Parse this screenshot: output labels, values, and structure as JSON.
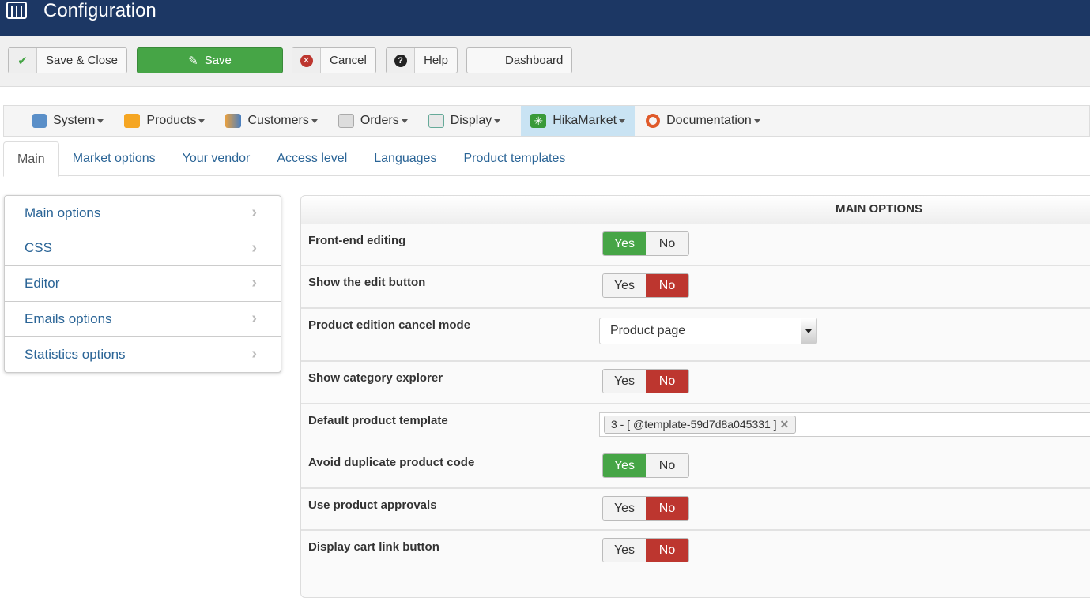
{
  "header": {
    "title": "Configuration",
    "icon": "sliders-icon"
  },
  "toolbar": {
    "save_close": "Save & Close",
    "save": "Save",
    "cancel": "Cancel",
    "help": "Help",
    "dashboard": "Dashboard"
  },
  "menu": [
    {
      "label": "System",
      "icon": "tools-icon"
    },
    {
      "label": "Products",
      "icon": "box-icon"
    },
    {
      "label": "Customers",
      "icon": "users-icon"
    },
    {
      "label": "Orders",
      "icon": "orders-icon"
    },
    {
      "label": "Display",
      "icon": "display-icon"
    },
    {
      "label": "HikaMarket",
      "icon": "hikamarket-icon"
    },
    {
      "label": "Documentation",
      "icon": "lifebuoy-icon"
    }
  ],
  "tabs": [
    "Main",
    "Market options",
    "Your vendor",
    "Access level",
    "Languages",
    "Product templates"
  ],
  "sidebar": [
    "Main options",
    "CSS",
    "Editor",
    "Emails options",
    "Statistics options"
  ],
  "panel": {
    "title": "MAIN OPTIONS",
    "yes": "Yes",
    "no": "No",
    "rows": [
      {
        "label": "Front-end editing",
        "value": "Yes"
      },
      {
        "label": "Show the edit button",
        "value": "No"
      },
      {
        "label": "Product edition cancel mode",
        "value": "Product page"
      },
      {
        "label": "Show category explorer",
        "value": "No"
      },
      {
        "label": "Default product template",
        "value": "3 - [ @template-59d7d8a045331 ]"
      },
      {
        "label": "Avoid duplicate product code",
        "value": "Yes"
      },
      {
        "label": "Use product approvals",
        "value": "No"
      },
      {
        "label": "Display cart link button",
        "value": "No"
      }
    ]
  },
  "colors": {
    "header": "#1c3764",
    "green": "#46a546",
    "red": "#bd362f",
    "link": "#2a6496"
  }
}
